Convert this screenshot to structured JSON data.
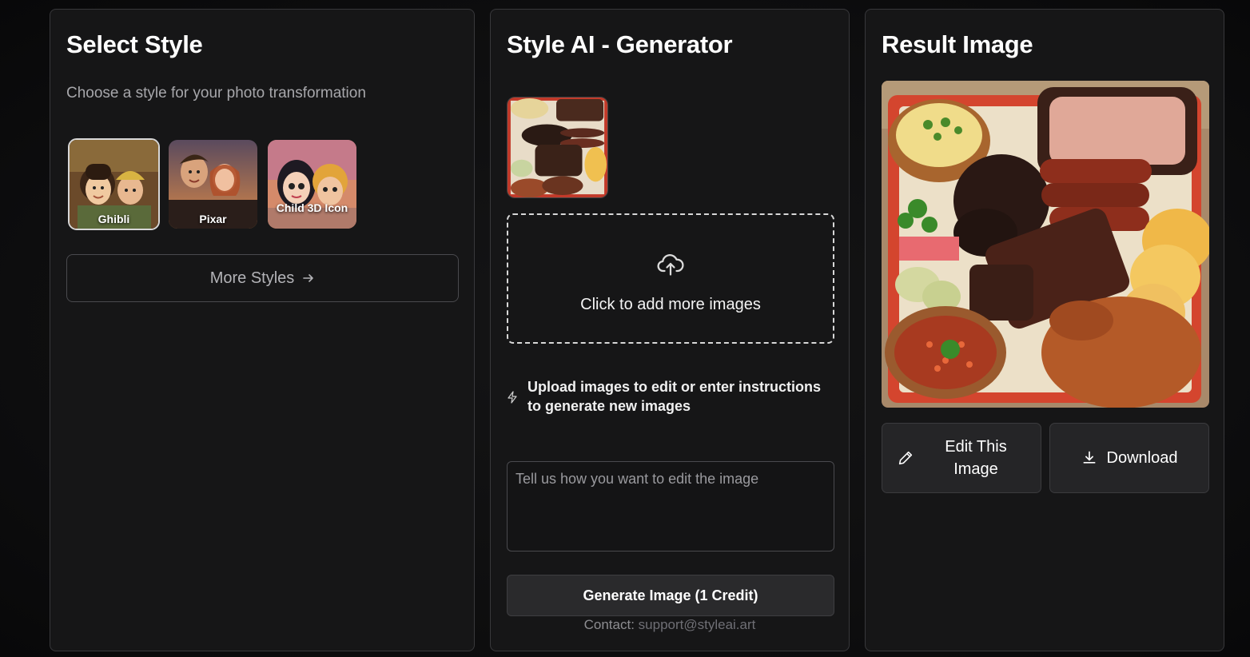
{
  "style_panel": {
    "title": "Select Style",
    "subtitle": "Choose a style for your photo transformation",
    "styles": [
      {
        "label": "Ghibli",
        "selected": true
      },
      {
        "label": "Pixar",
        "selected": false
      },
      {
        "label": "Child 3D Icon",
        "selected": false
      }
    ],
    "more_styles_label": "More Styles",
    "more_styles_icon": "arrow-right-icon"
  },
  "generator_panel": {
    "title": "Style AI - Generator",
    "dropzone_icon": "cloud-upload-icon",
    "dropzone_text": "Click to add more images",
    "hint_icon": "lightning-icon",
    "hint_text": "Upload images to edit or enter instructions to generate new images",
    "prompt_placeholder": "Tell us how you want to edit the image",
    "generate_label": "Generate Image (1 Credit)",
    "contact_label": "Contact:",
    "contact_email": "support@styleai.art"
  },
  "result_panel": {
    "title": "Result Image",
    "edit_label": "Edit This Image",
    "edit_icon": "pencil-icon",
    "download_label": "Download",
    "download_icon": "download-icon"
  },
  "colors": {
    "background": "#0d0d0e",
    "panel": "#161617",
    "border": "#38383b",
    "button": "#2a2a2c"
  }
}
